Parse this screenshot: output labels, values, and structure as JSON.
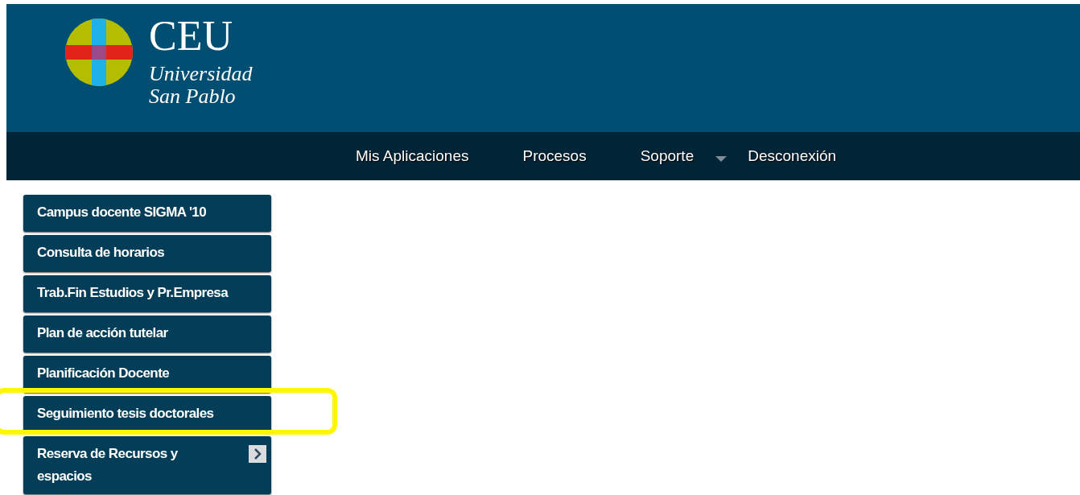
{
  "header": {
    "logo_text": "CEU",
    "logo_subtitle_1": "Universidad",
    "logo_subtitle_2": "San Pablo"
  },
  "nav": [
    {
      "label": "Mis Aplicaciones",
      "dropdown": false
    },
    {
      "label": "Procesos",
      "dropdown": false
    },
    {
      "label": "Soporte",
      "dropdown": true
    },
    {
      "label": "Desconexión",
      "dropdown": false
    }
  ],
  "menu": [
    {
      "label": "Campus docente SIGMA '10",
      "highlighted": false,
      "submenu": false
    },
    {
      "label": "Consulta de horarios",
      "highlighted": false,
      "submenu": false
    },
    {
      "label": "Trab.Fin Estudios y Pr.Empresa",
      "highlighted": false,
      "submenu": false
    },
    {
      "label": "Plan de acción tutelar",
      "highlighted": false,
      "submenu": false
    },
    {
      "label": "Planificación Docente",
      "highlighted": false,
      "submenu": false
    },
    {
      "label": "Seguimiento tesis doctorales",
      "highlighted": true,
      "submenu": false
    },
    {
      "label": "Reserva de Recursos y espacios",
      "highlighted": false,
      "submenu": true
    }
  ]
}
